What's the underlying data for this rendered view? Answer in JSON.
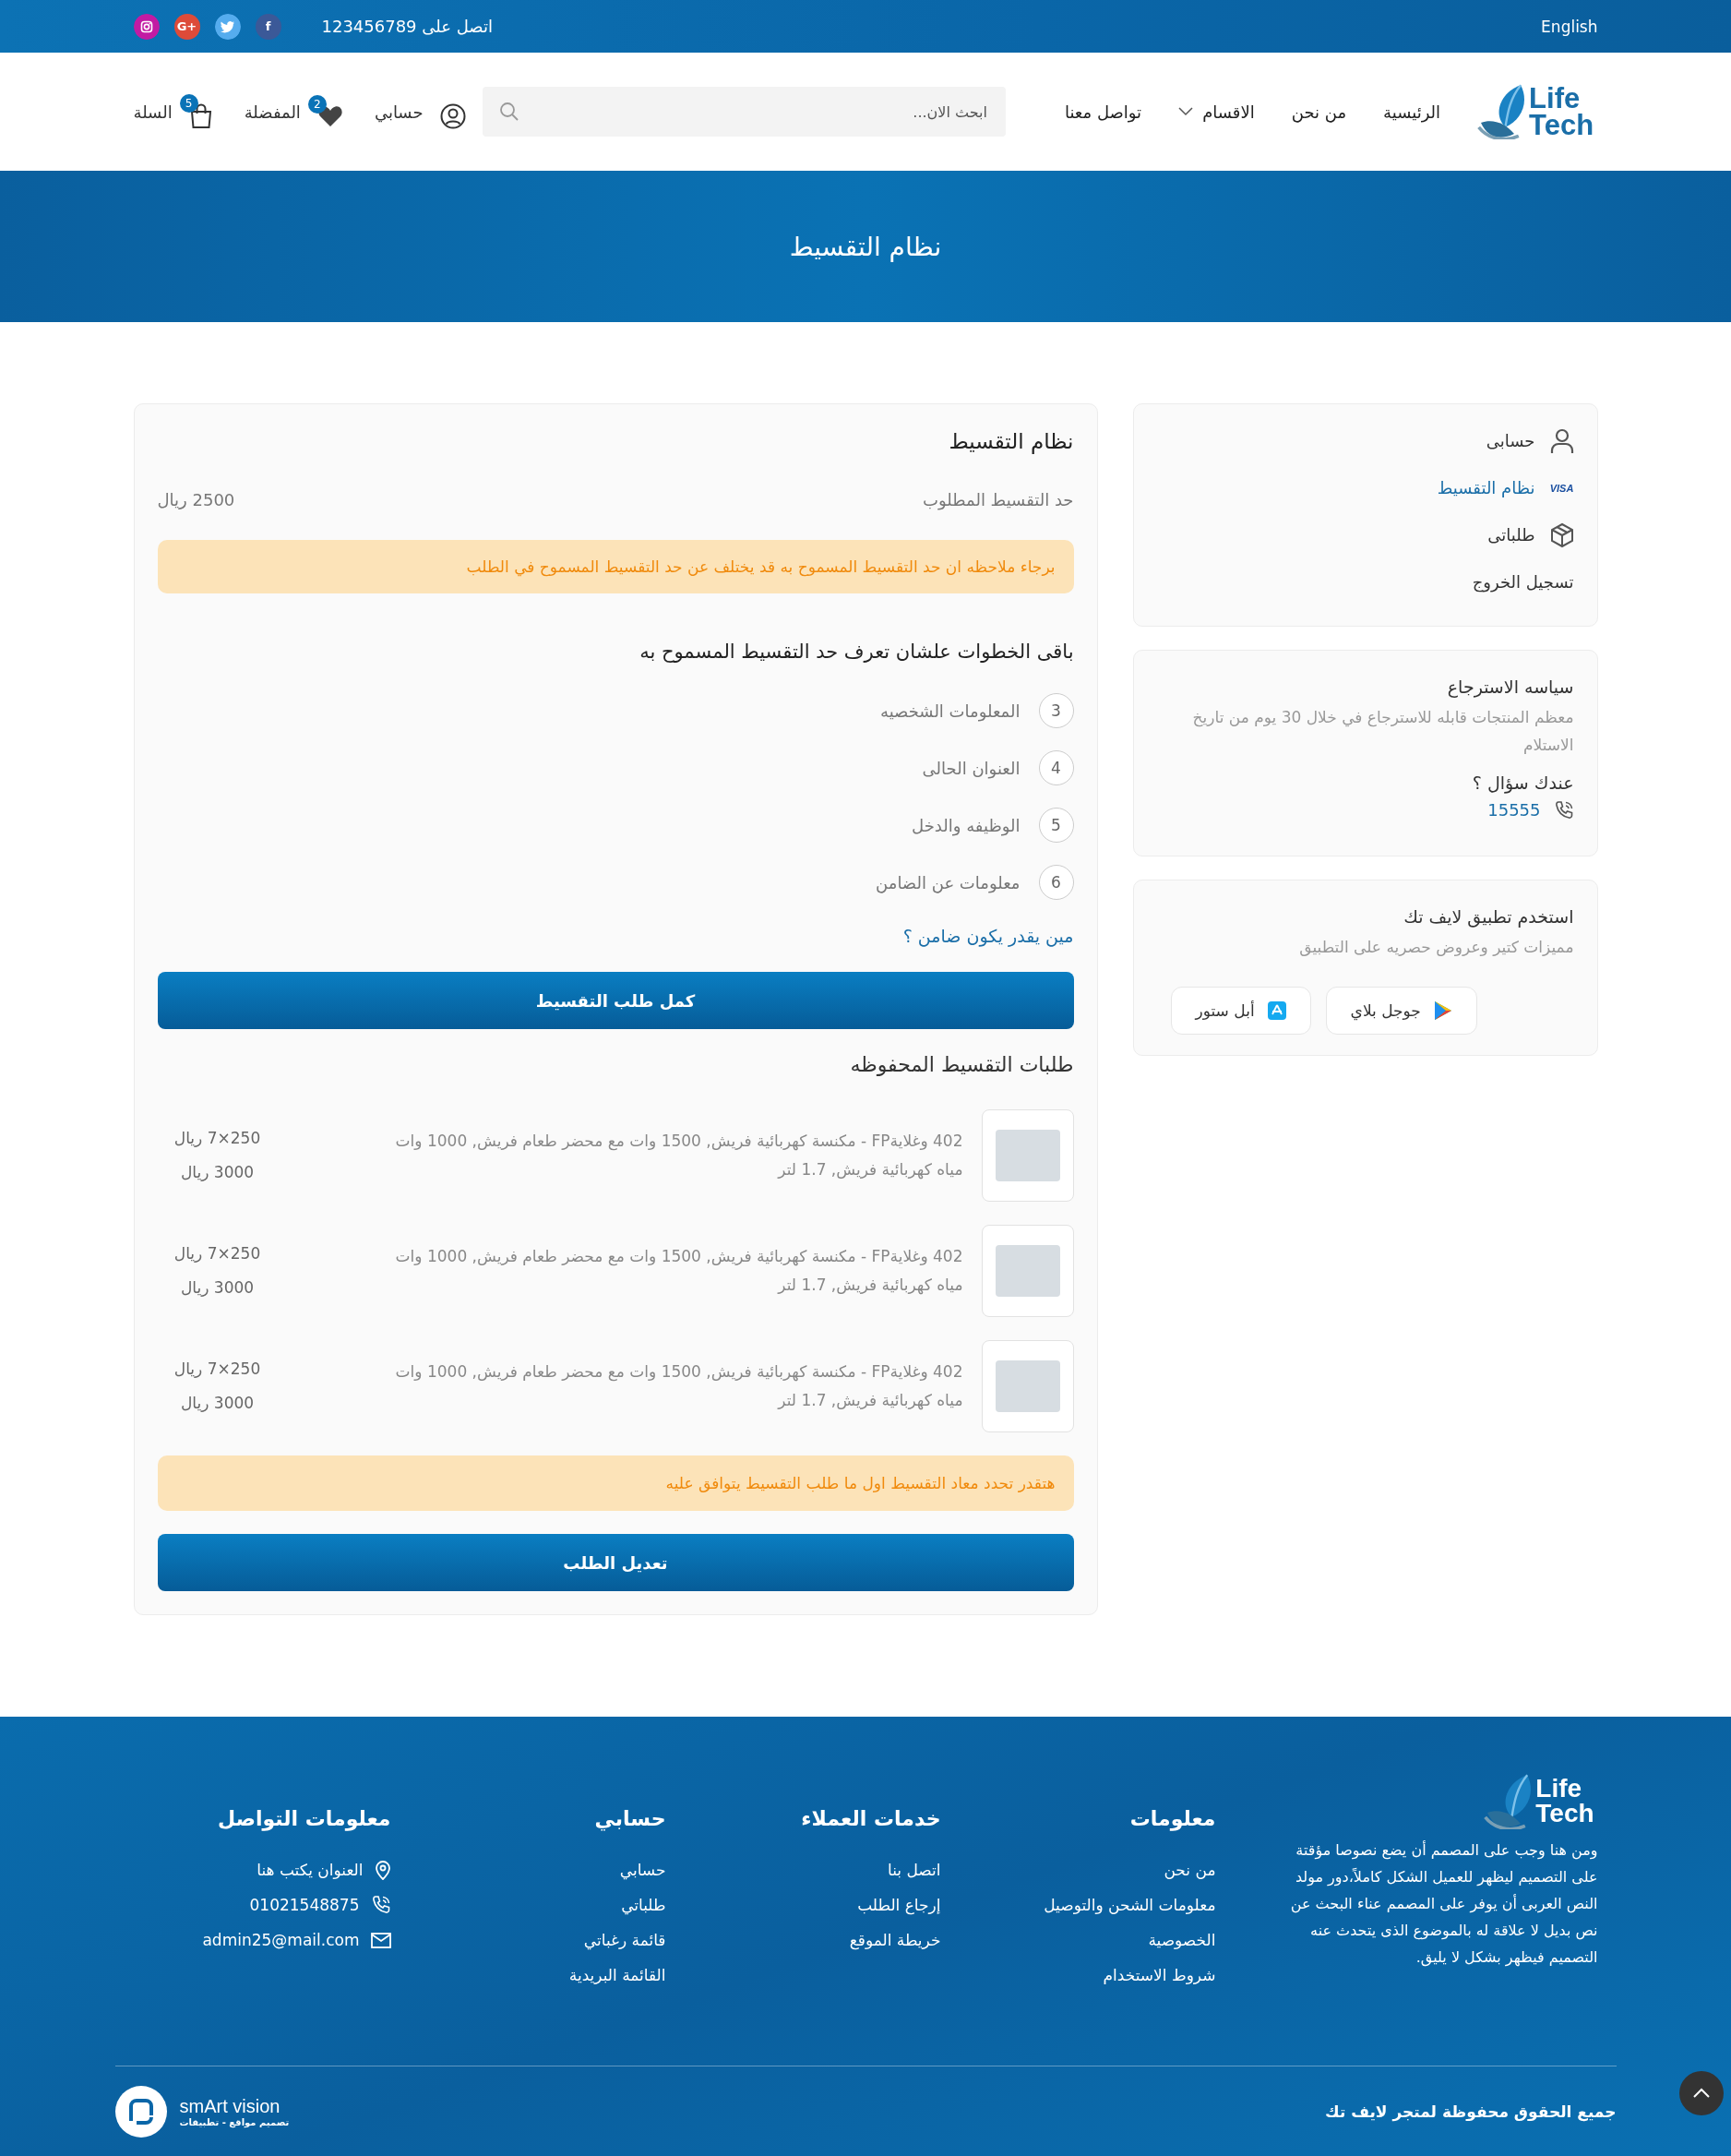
{
  "top_bar": {
    "language": "English",
    "contact": "اتصل على 123456789",
    "social": [
      {
        "kind": "facebook",
        "label": "f",
        "color": "#3b5998"
      },
      {
        "kind": "twitter",
        "color": "#55acee"
      },
      {
        "kind": "google-plus",
        "label": "G+",
        "color": "#dd4b39"
      },
      {
        "kind": "instagram",
        "color": "#c21ba3"
      }
    ]
  },
  "header": {
    "logo": "Life Tech",
    "nav": [
      {
        "label": "الرئيسية",
        "dropdown": false
      },
      {
        "label": "من نحن",
        "dropdown": false
      },
      {
        "label": "الاقسام",
        "dropdown": true
      },
      {
        "label": "تواصل معنا",
        "dropdown": false
      }
    ],
    "search": {
      "placeholder": "ابحث الان..."
    },
    "actions": [
      {
        "kind": "account",
        "label": "حسابي"
      },
      {
        "kind": "favorites",
        "label": "المفضلة",
        "badge": "2"
      },
      {
        "kind": "cart",
        "label": "السلة",
        "badge": "5"
      }
    ]
  },
  "banner": {
    "title": "نظام التقسيط"
  },
  "installment": {
    "title": "نظام التقسيط",
    "limit_label": "حد التقسيط المطلوب",
    "limit_value": "2500 ريال",
    "notice": "برجاء ملاحظه ان حد التقسيط المسموح به قد يختلف عن حد التقسيط المسموح في الطلب",
    "steps_title": "باقى الخطوات علشان تعرف حد التقسيط المسموح به",
    "steps": [
      {
        "number": "3",
        "label": "المعلومات الشخصيه"
      },
      {
        "number": "4",
        "label": "العنوان الحالى"
      },
      {
        "number": "5",
        "label": "الوظيفه والدخل"
      },
      {
        "number": "6",
        "label": "معلومات عن الضامن"
      }
    ],
    "guarantor_link": "مين يقدر يكون ضامن ؟",
    "complete_button": "كمل طلب التقسيط",
    "saved_title": "طلبات التقسيط المحفوظه",
    "saved_orders": [
      {
        "description": "402 وغلايةFP - مكنسة كهربائية فريش, 1500 وات مع محضر طعام فريش, 1000 وات مياه كهربائية فريش, 1.7 لتر",
        "installment": "250×7 ريال",
        "total": "3000 ريال"
      },
      {
        "description": "402 وغلايةFP - مكنسة كهربائية فريش, 1500 وات مع محضر طعام فريش, 1000 وات مياه كهربائية فريش, 1.7 لتر",
        "installment": "250×7 ريال",
        "total": "3000 ريال"
      },
      {
        "description": "402 وغلايةFP - مكنسة كهربائية فريش, 1500 وات مع محضر طعام فريش, 1000 وات مياه كهربائية فريش, 1.7 لتر",
        "installment": "250×7 ريال",
        "total": "3000 ريال"
      }
    ],
    "schedule_notice": "هتقدر تحدد معاد التقسيط اول ما طلب التقسيط يتوافق عليه",
    "edit_button": "تعديل الطلب"
  },
  "sidebar": {
    "nav": [
      {
        "kind": "account",
        "label": "حسابى",
        "selected": false
      },
      {
        "kind": "card",
        "card_logo": "VISA",
        "label": "نظام التقسيط",
        "selected": true
      },
      {
        "kind": "orders",
        "label": "طلباتى",
        "selected": false
      },
      {
        "kind": "logout",
        "label": "تسجيل الخروج",
        "selected": false
      }
    ],
    "return_policy": {
      "title": "سياسه الاسترجاع",
      "text": "معظم المنتجات قابله للاسترجاع في خلال 30 يوم من تاريخ الاستلام",
      "question": "عندك سؤال ؟",
      "phone": "15555"
    },
    "app": {
      "title": "استخدم تطبيق لايف تك",
      "subtitle": "مميزات كتير وعروض حصريه على التطبيق",
      "stores": [
        {
          "kind": "google-play",
          "label": "جوجل بلاي"
        },
        {
          "kind": "app-store",
          "label": "أبل ستور"
        }
      ]
    }
  },
  "footer": {
    "logo": "Life Tech",
    "about": "ومن هنا وجب على المصمم أن يضع نصوصا مؤقتة على التصميم ليظهر للعميل الشكل كاملاً،دور مولد النص العربى أن يوفر على المصمم عناء البحث عن نص بديل لا علاقة له بالموضوع الذى يتحدث عنه التصميم فيظهر بشكل لا يليق.",
    "columns": [
      {
        "title": "معلومات",
        "links": [
          "من نحن",
          "معلومات الشحن والتوصيل",
          "الخصوصية",
          "شروط الاستخدام"
        ]
      },
      {
        "title": "خدمات العملاء",
        "links": [
          "اتصل بنا",
          "إرجاع الطلب",
          "خريطة الموقع"
        ]
      },
      {
        "title": "حسابي",
        "links": [
          "حسابي",
          "طلباتي",
          "قائمة رغباتي",
          "القائمة البريدية"
        ]
      }
    ],
    "contact": {
      "title": "معلومات التواصل",
      "items": [
        {
          "kind": "location",
          "text": "العنوان يكتب هنا"
        },
        {
          "kind": "phone",
          "text": "01021548875"
        },
        {
          "kind": "email",
          "text": "admin25@mail.com"
        }
      ]
    },
    "copyright": "جميع الحقوق محفوظة لمتجر لايف تك",
    "credit": {
      "name": "smArt vision",
      "tagline": "تصميم مواقع - تطبيقات"
    }
  }
}
